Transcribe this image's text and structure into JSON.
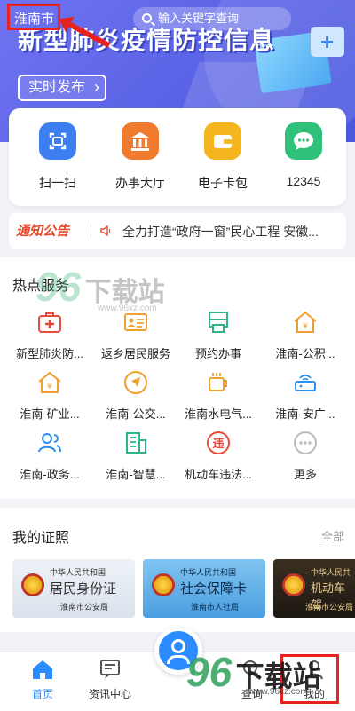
{
  "header": {
    "city": "淮南市",
    "search_placeholder": "输入关键字查询",
    "banner_title": "新型肺炎疫情防控信息",
    "publish_button": "实时发布"
  },
  "quick_actions": [
    {
      "label": "扫一扫",
      "icon": "scan-icon",
      "color": "#3d7ff0"
    },
    {
      "label": "办事大厅",
      "icon": "hall-icon",
      "color": "#f07a2e"
    },
    {
      "label": "电子卡包",
      "icon": "wallet-icon",
      "color": "#f5b51e"
    },
    {
      "label": "12345",
      "icon": "chat-icon",
      "color": "#2fc07a"
    }
  ],
  "notice": {
    "tag": "通知公告",
    "text": "全力打造“政府一窗”民心工程 安徽..."
  },
  "services": {
    "title": "热点服务",
    "items": [
      {
        "label": "新型肺炎防...",
        "icon": "medkit-icon",
        "color": "#e84a3a"
      },
      {
        "label": "返乡居民服务",
        "icon": "id-card-icon",
        "color": "#f0a02e"
      },
      {
        "label": "预约办事",
        "icon": "printer-icon",
        "color": "#2fb38a"
      },
      {
        "label": "淮南-公积...",
        "icon": "fund-house-icon",
        "color": "#f0a02e"
      },
      {
        "label": "淮南-矿业...",
        "icon": "yuan-house-icon",
        "color": "#f0a02e"
      },
      {
        "label": "淮南-公交...",
        "icon": "navigation-icon",
        "color": "#f0a02e"
      },
      {
        "label": "淮南水电气...",
        "icon": "cup-icon",
        "color": "#f0a02e"
      },
      {
        "label": "淮南-安广...",
        "icon": "router-icon",
        "color": "#2f8ff0"
      },
      {
        "label": "淮南-政务...",
        "icon": "people-icon",
        "color": "#2f8ff0"
      },
      {
        "label": "淮南-智慧...",
        "icon": "building-icon",
        "color": "#2fb38a"
      },
      {
        "label": "机动车违法...",
        "icon": "violation-icon",
        "color": "#e84a3a"
      },
      {
        "label": "更多",
        "icon": "more-icon",
        "color": "#aaaaaa"
      }
    ]
  },
  "certificates": {
    "title": "我的证照",
    "all_label": "全部",
    "cards": [
      {
        "top": "中华人民共和国",
        "name": "居民身份证",
        "org": "淮南市公安局"
      },
      {
        "top": "中华人民共和国",
        "name": "社会保障卡",
        "org": "淮南市人社局"
      },
      {
        "top": "中华人民共",
        "name": "机动车驾",
        "org": "淮南市公安局"
      }
    ]
  },
  "nav": {
    "items": [
      {
        "label": "首页",
        "icon": "home-icon"
      },
      {
        "label": "资讯中心",
        "icon": "news-icon"
      },
      {
        "label": "",
        "icon": "service-center-icon"
      },
      {
        "label": "查询",
        "icon": "query-icon"
      },
      {
        "label": "我的",
        "icon": "user-icon"
      }
    ]
  },
  "watermark": {
    "number": "96",
    "text": "下载站",
    "url": "www.96xz.com"
  },
  "colors": {
    "accent": "#2a8cff",
    "banner": "#5a63e6",
    "notice": "#e84a2e",
    "annotation": "#e8231f"
  }
}
